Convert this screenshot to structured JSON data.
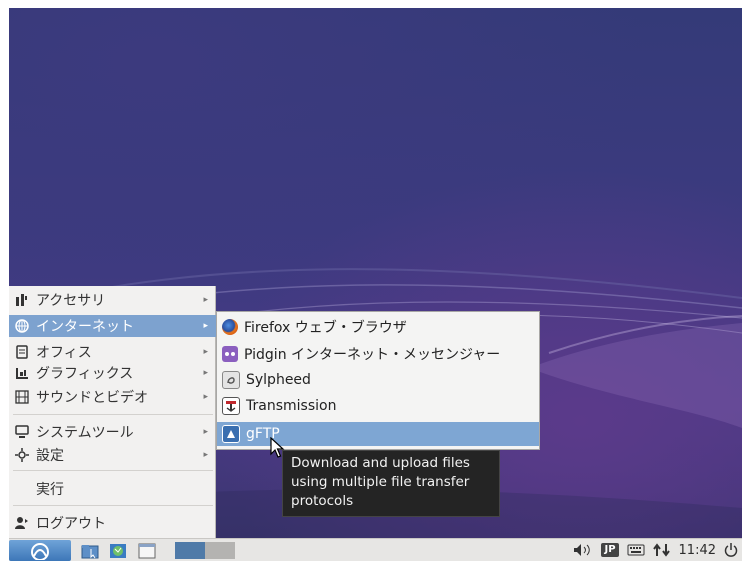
{
  "menu": {
    "items": [
      {
        "label": "アクセサリ",
        "icon": "accessories-icon"
      },
      {
        "label": "インターネット",
        "icon": "globe-icon"
      },
      {
        "label": "オフィス",
        "icon": "document-icon"
      },
      {
        "label": "グラフィックス",
        "icon": "graphics-icon"
      },
      {
        "label": "サウンドとビデオ",
        "icon": "film-icon"
      },
      {
        "label": "システムツール",
        "icon": "monitor-icon"
      },
      {
        "label": "設定",
        "icon": "gear-icon"
      },
      {
        "label": "実行"
      },
      {
        "label": "ログアウト",
        "icon": "logout-icon"
      }
    ],
    "arrow": "▸"
  },
  "submenu": {
    "items": [
      {
        "label": "Firefox ウェブ・ブラウザ",
        "icon": "firefox-icon"
      },
      {
        "label": "Pidgin インターネット・メッセンジャー",
        "icon": "pidgin-icon"
      },
      {
        "label": "Sylpheed",
        "icon": "sylpheed-icon"
      },
      {
        "label": "Transmission",
        "icon": "transmission-icon"
      },
      {
        "label": "gFTP",
        "icon": "gftp-icon"
      }
    ]
  },
  "tooltip": {
    "lines": [
      "Download and upload files",
      "using multiple file transfer",
      "protocols"
    ]
  },
  "taskbar": {
    "keyboard_layout": "JP",
    "clock": "11:42"
  },
  "colors": {
    "menu_highlight": "#7da2cf",
    "tooltip_bg": "#242424",
    "taskbar_bg": "#e7e6e4"
  }
}
